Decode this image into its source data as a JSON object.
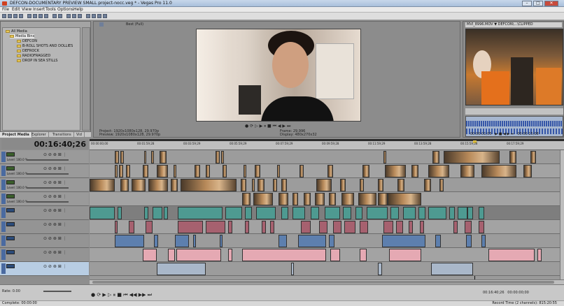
{
  "window": {
    "title": "DEFCON-DOCUMENTARY PREVIEW SMALL project-nocc.veg * - Vegas Pro 11.0"
  },
  "window_buttons": {
    "min": "–",
    "max": "□",
    "close": "✕"
  },
  "menu": [
    "File",
    "Edit",
    "View",
    "Insert",
    "Tools",
    "Options",
    "Help"
  ],
  "explorer": {
    "tree": [
      {
        "label": "All Media",
        "indent": 0
      },
      {
        "label": "Media Bins",
        "indent": 1,
        "selected": true
      },
      {
        "label": "DEFCON",
        "indent": 2
      },
      {
        "label": "B-ROLL SHOTS AND DOLLIES",
        "indent": 2
      },
      {
        "label": "DEFROCK",
        "indent": 2
      },
      {
        "label": "RADIOFRAGGED",
        "indent": 2
      },
      {
        "label": "DROP IN SEA STILLS",
        "indent": 2
      }
    ],
    "tabs": [
      "Project Media",
      "Explorer",
      "Transitions",
      "Vid"
    ]
  },
  "preview": {
    "quality": "Best (Full)",
    "controls": "● ⟳ ▷ ▶ ⏸ ■ ⏮ ◀ ▶ ⏭",
    "project_label": "Project:",
    "project_value": "1920x1080x128, 29.970p",
    "preview_label": "Preview:",
    "preview_value": "1920x1080x128, 29.970p",
    "frame_label": "Frame:",
    "frame_value": "29,996",
    "display_label": "Display:",
    "display_value": "480x270x32"
  },
  "trimmer": {
    "header": "MVI_8996.MOV  ▼ DEFCON\\...\\CLIPPED",
    "tc_in": "00:00:01;05",
    "tc_out": "00:00:15;08",
    "controls": "▶ ■ ◀ ▶ ⏭"
  },
  "timeline": {
    "timecode": "00:16:40;26",
    "ruler_labels": [
      "00:00:00;00",
      "00:01:59;28",
      "00:03:59;29",
      "00:05:59;29",
      "00:07:59;29",
      "00:09:59;28",
      "00:11:59;29",
      "00:13:59;28",
      "00:15:59;28",
      "00:17:59;29"
    ],
    "tracks": [
      {
        "level": "Level: 100.0 %",
        "kind": "video"
      },
      {
        "level": "Level: 100.0 %",
        "kind": "video"
      },
      {
        "level": "Level: 100.0 %",
        "kind": "video"
      },
      {
        "level": "Level: 100.0 %",
        "kind": "video"
      },
      {
        "level": "",
        "kind": "audio"
      },
      {
        "level": "",
        "kind": "audio"
      },
      {
        "level": "",
        "kind": "audio"
      },
      {
        "level": "",
        "kind": "audio"
      },
      {
        "level": "",
        "kind": "audio"
      }
    ]
  },
  "bottom": {
    "rate": "Rate: 0.00",
    "transport": "● ⟳ ▶ ▷ ⏸ ■ ⏮ ◀◀ ▶▶ ⏭",
    "end_time": "00:16:40;26",
    "end_time2": "00:00:00;00",
    "status_left": "Complete: 00:00:00",
    "status_right": "Record Time (2 channels): 815:20:55"
  },
  "colors": {
    "accent": "#4a6aa0",
    "titlebar": "#b8cbe3"
  }
}
